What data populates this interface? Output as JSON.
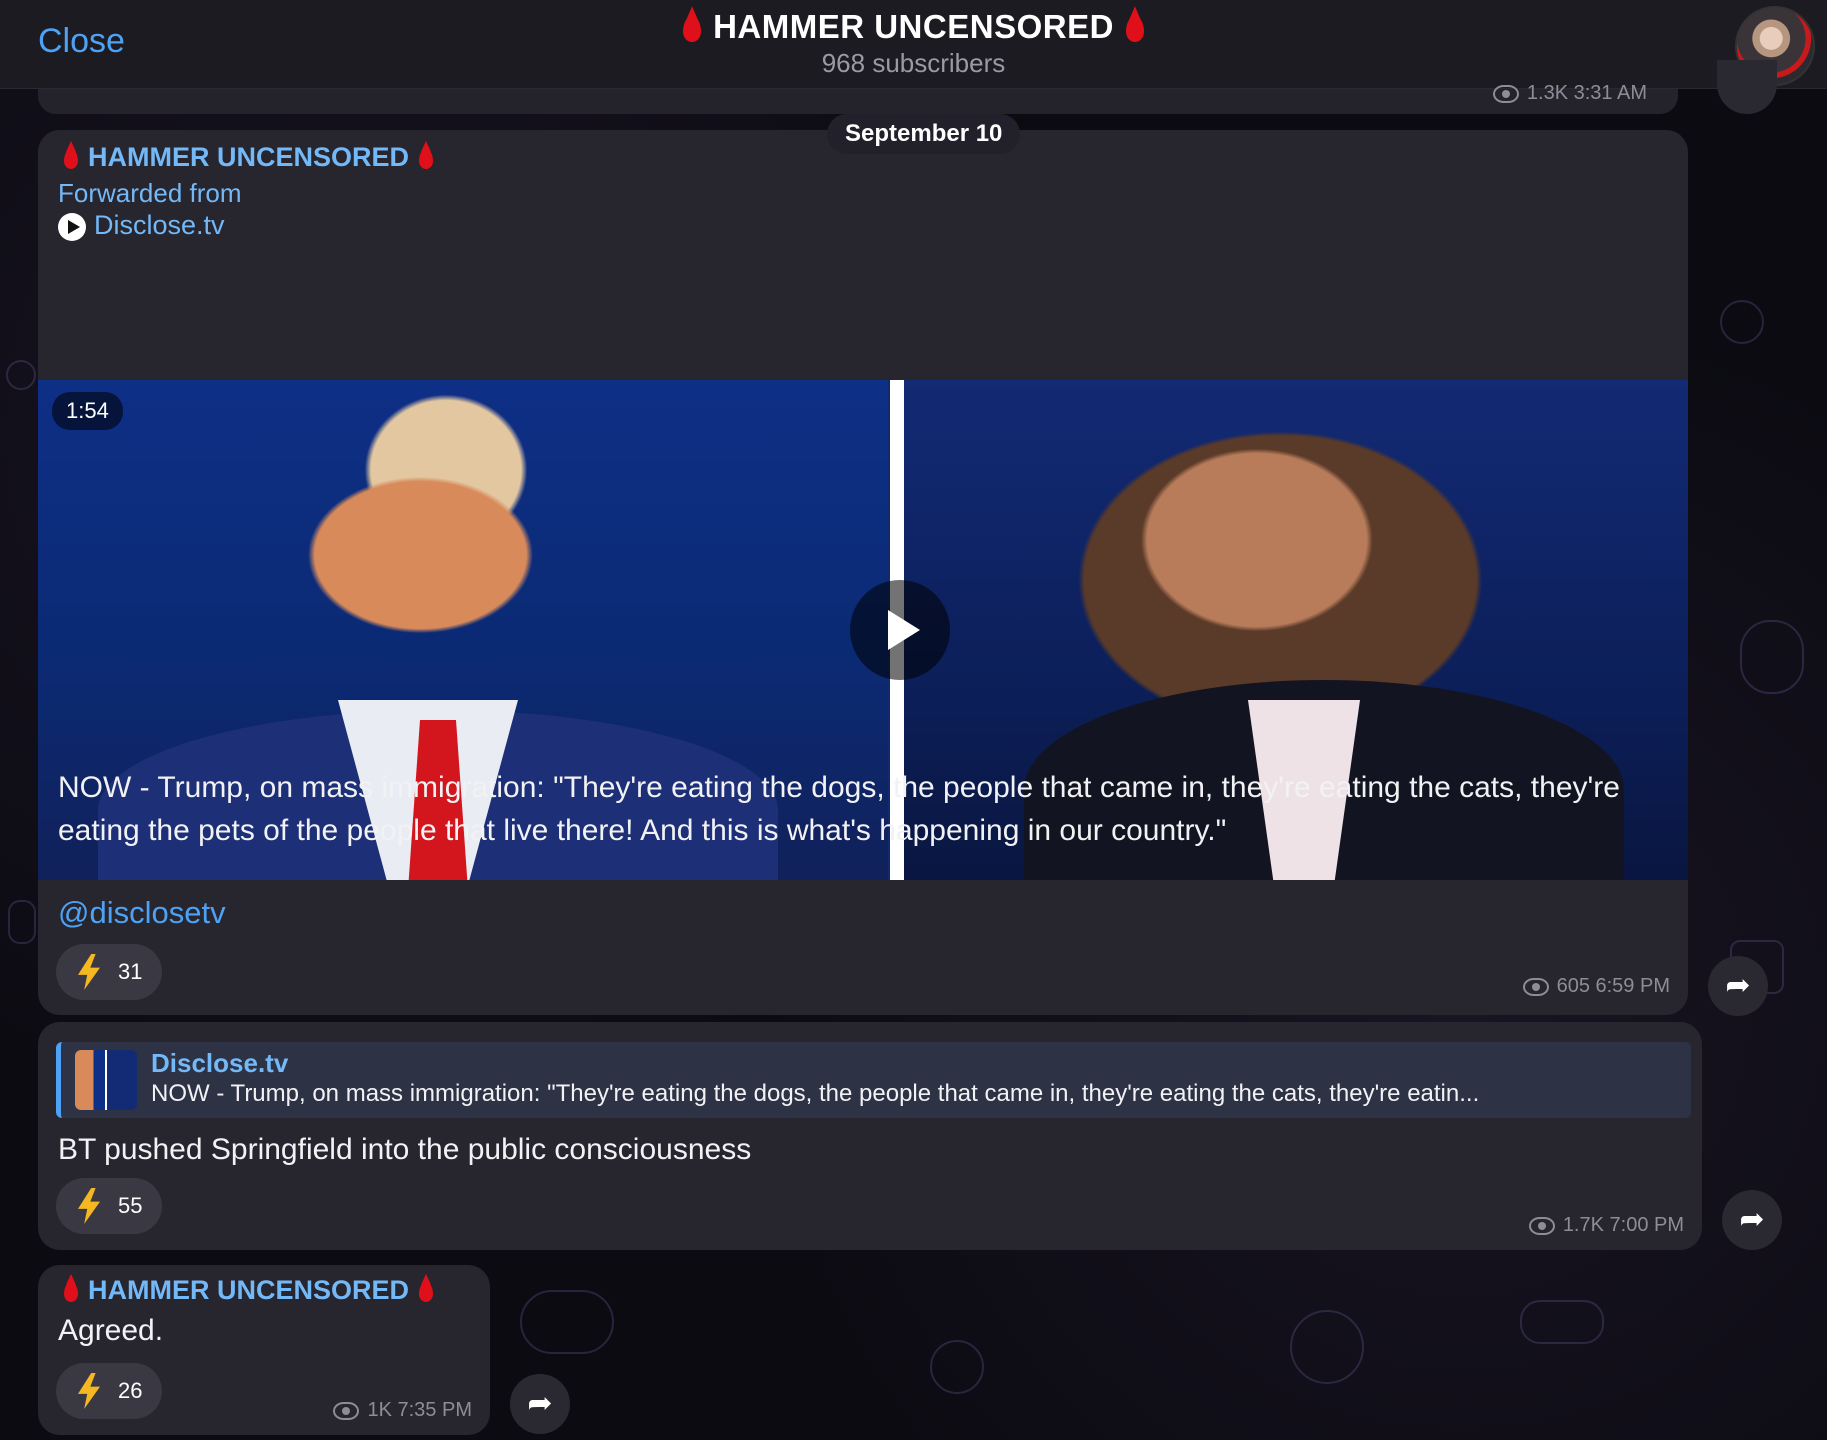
{
  "header": {
    "close_label": "Close",
    "channel_title": "HAMMER UNCENSORED",
    "subscribers": "968 subscribers"
  },
  "previous_message": {
    "meta": "1.3K 3:31 AM"
  },
  "date_separator": "September 10",
  "messages": [
    {
      "sender": "HAMMER UNCENSORED",
      "forwarded_label": "Forwarded from",
      "forwarded_source": "Disclose.tv",
      "video_duration": "1:54",
      "text": "NOW - Trump, on mass immigration: \"They're eating the dogs, the people that came in, they're eating the cats, they're eating the pets of the people that live there! And this is what's happening in our country.\"",
      "mention": "@disclosetv",
      "reaction_count": "31",
      "meta": "605 6:59 PM"
    },
    {
      "reply_title": "Disclose.tv",
      "reply_text": "NOW - Trump, on mass immigration: \"They're eating the dogs, the people that came in, they're eating the cats, they're eatin...",
      "text": "BT pushed Springfield into the public consciousness",
      "reaction_count": "55",
      "meta": "1.7K 7:00 PM"
    },
    {
      "sender": "HAMMER UNCENSORED",
      "text": "Agreed.",
      "reaction_count": "26",
      "meta": "1K 7:35 PM"
    }
  ],
  "colors": {
    "accent": "#4ea2f5",
    "sender": "#73b8f7",
    "drop": "#e0101a",
    "bolt": "#f5b821",
    "bubble": "#27252e"
  }
}
